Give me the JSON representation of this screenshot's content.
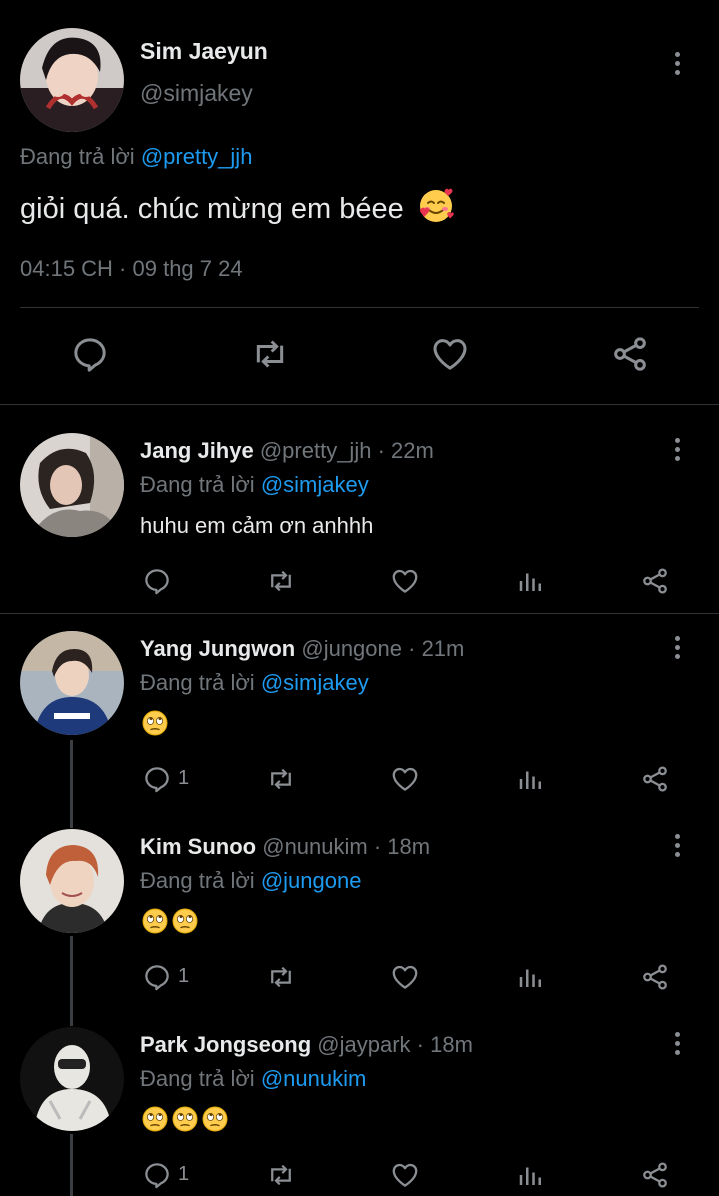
{
  "main_tweet": {
    "name": "Sim Jaeyun",
    "handle": "@simjakey",
    "replying_prefix": "Đang trả lời",
    "replying_to": "@pretty_jjh",
    "text": "giỏi quá. chúc mừng em béee",
    "emoji": "smiling-face-with-hearts",
    "timestamp": "04:15 CH · 09 thg 7 24"
  },
  "replies": [
    {
      "name": "Jang Jihye",
      "handle": "@pretty_jjh",
      "time": "· 22m",
      "replying_prefix": "Đang trả lời",
      "replying_to": "@simjakey",
      "text": "huhu em cảm ơn anhhh",
      "reply_count": ""
    },
    {
      "name": "Yang Jungwon",
      "handle": "@jungone",
      "time": "· 21m",
      "replying_prefix": "Đang trả lời",
      "replying_to": "@simjakey",
      "emoji_count": 1,
      "reply_count": "1"
    },
    {
      "name": "Kim Sunoo",
      "handle": "@nunukim",
      "time": "· 18m",
      "replying_prefix": "Đang trả lời",
      "replying_to": "@jungone",
      "emoji_count": 2,
      "reply_count": "1"
    },
    {
      "name": "Park Jongseong",
      "handle": "@jaypark",
      "time": "· 18m",
      "replying_prefix": "Đang trả lời",
      "replying_to": "@nunukim",
      "emoji_count": 3,
      "reply_count": "1"
    }
  ],
  "colors": {
    "background": "#000000",
    "link": "#1d9bf0",
    "muted": "#71767b",
    "divider": "#2f3336"
  }
}
